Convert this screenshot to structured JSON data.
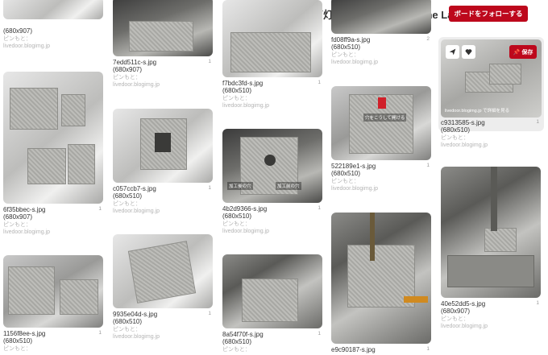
{
  "header": {
    "title": "石灯籠 ishidourou \"Stone Lante",
    "follow_label": "ボードをフォローする"
  },
  "hover": {
    "save_label": "保存",
    "visit_label": "livedoor.blogimg.jp で詳細を見る"
  },
  "pins": [
    {
      "file": "",
      "dims": "(680x907)",
      "from": "ピンもと：",
      "source": "livedoor.blogimg.jp",
      "repins": ""
    },
    {
      "file": "6f35bbec-s.jpg",
      "dims": "(680x907)",
      "from": "ピンもと：",
      "source": "livedoor.blogimg.jp",
      "repins": "1"
    },
    {
      "file": "1156f8ee-s.jpg",
      "dims": "(680x510)",
      "from": "ピンもと：",
      "source": "",
      "repins": "1"
    },
    {
      "file": "7edd511c-s.jpg",
      "dims": "(680x907)",
      "from": "ピンもと：",
      "source": "livedoor.blogimg.jp",
      "repins": "1"
    },
    {
      "file": "c057ccb7-s.jpg",
      "dims": "(680x510)",
      "from": "ピンもと：",
      "source": "livedoor.blogimg.jp",
      "repins": "1"
    },
    {
      "file": "9935e04d-s.jpg",
      "dims": "(680x510)",
      "from": "ピンもと：",
      "source": "livedoor.blogimg.jp",
      "repins": "1"
    },
    {
      "file": "f7bdc3fd-s.jpg",
      "dims": "(680x510)",
      "from": "ピンもと：",
      "source": "livedoor.blogimg.jp",
      "repins": "1"
    },
    {
      "file": "4b2d9366-s.jpg",
      "dims": "(680x510)",
      "from": "ピンもと：",
      "source": "livedoor.blogimg.jp",
      "repins": "1"
    },
    {
      "file": "8a54f70f-s.jpg",
      "dims": "(680x510)",
      "from": "ピンもと：",
      "source": "",
      "repins": "1"
    },
    {
      "file": "fd08ff9a-s.jpg",
      "dims": "(680x510)",
      "from": "ピンもと：",
      "source": "livedoor.blogimg.jp",
      "repins": "2"
    },
    {
      "file": "522189e1-s.jpg",
      "dims": "(680x510)",
      "from": "ピンもと：",
      "source": "livedoor.blogimg.jp",
      "repins": "1"
    },
    {
      "file": "e9c90187-s.jpg",
      "dims": "",
      "from": "",
      "source": "",
      "repins": "1"
    },
    {
      "file": "c9313585-s.jpg",
      "dims": "(680x510)",
      "from": "ピンもと：",
      "source": "livedoor.blogimg.jp",
      "repins": "1"
    },
    {
      "file": "40e52dd5-s.jpg",
      "dims": "(680x907)",
      "from": "ピンもと：",
      "source": "livedoor.blogimg.jp",
      "repins": "1"
    }
  ],
  "overlays": {
    "mid_left": "加工後の穴",
    "mid_right": "加工前の穴",
    "arrow_text": "穴をこうして開ける"
  }
}
